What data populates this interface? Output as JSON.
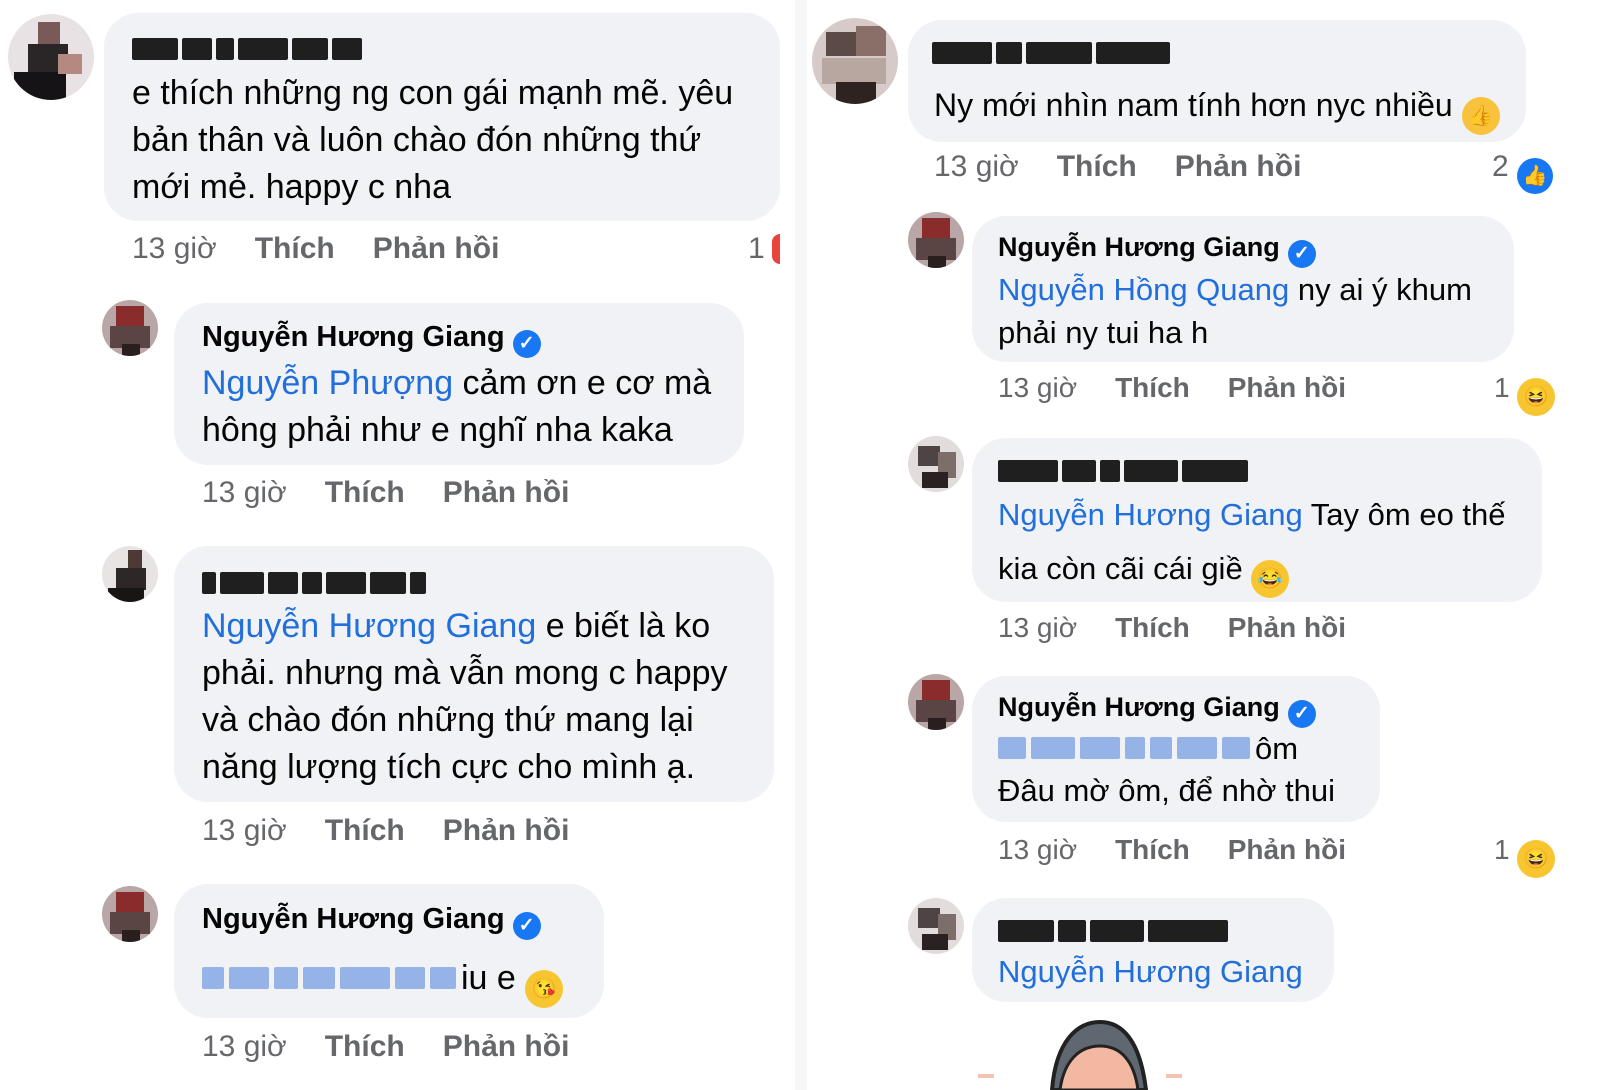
{
  "left": {
    "c1": {
      "author": "",
      "text": "e thích những ng con gái mạnh mẽ. yêu bản thân và luôn chào đón những thứ mới mẻ. happy c nha",
      "time": "13 giờ",
      "like": "Thích",
      "reply": "Phản hồi",
      "count": "1"
    },
    "c2": {
      "author": "Nguyễn Hương Giang",
      "mention": "Nguyễn Phượng",
      "text": " cảm ơn e cơ mà hông phải như e nghĩ nha kaka",
      "time": "13 giờ",
      "like": "Thích",
      "reply": "Phản hồi"
    },
    "c3": {
      "author": "",
      "mention": "Nguyễn Hương Giang",
      "text": " e biết là ko phải. nhưng mà vẫn mong c happy và chào đón những thứ mang lại năng lượng tích cực cho mình ạ.",
      "time": "13 giờ",
      "like": "Thích",
      "reply": "Phản hồi"
    },
    "c4": {
      "author": "Nguyễn Hương Giang",
      "text": "iu e",
      "emoji": "kiss-heart-emoji",
      "time": "13 giờ",
      "like": "Thích",
      "reply": "Phản hồi"
    }
  },
  "right": {
    "c1": {
      "author": "",
      "text": "Ny mới nhìn nam tính hơn nyc nhiều",
      "emoji": "thumbs-up-emoji",
      "time": "13 giờ",
      "like": "Thích",
      "reply": "Phản hồi",
      "count": "2"
    },
    "c2": {
      "author": "Nguyễn Hương Giang",
      "mention": "Nguyễn Hồng Quang",
      "text": " ny ai ý khum phải ny tui ha h",
      "time": "13 giờ",
      "like": "Thích",
      "reply": "Phản hồi",
      "count": "1"
    },
    "c3": {
      "author": "",
      "mention": "Nguyễn Hương Giang",
      "text": " Tay ôm eo thế kia còn cãi cái giề",
      "emoji": "laughing-tears-emoji",
      "time": "13 giờ",
      "like": "Thích",
      "reply": "Phản hồi"
    },
    "c4": {
      "author": "Nguyễn Hương Giang",
      "text_line1": "ôm",
      "text_line2": "Đâu mờ ôm, để nhờ thui",
      "time": "13 giờ",
      "like": "Thích",
      "reply": "Phản hồi",
      "count": "1"
    },
    "c5": {
      "author": "",
      "mention": "Nguyễn Hương Giang"
    }
  },
  "colors": {
    "bubble": "#f0f2f5",
    "mention": "#216fdb",
    "meta": "#65676b",
    "verified": "#1877f2"
  }
}
